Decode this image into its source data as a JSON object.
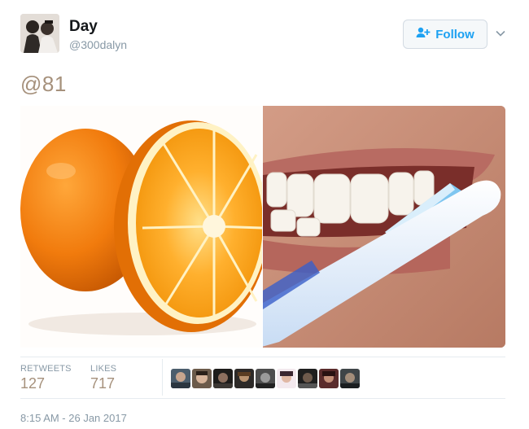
{
  "tweet": {
    "author_name": "Day",
    "author_handle": "@300dalyn",
    "text": "@81",
    "follow_label": "Follow",
    "timestamp": "8:15 AM - 26 Jan 2017"
  },
  "stats": {
    "retweets_label": "RETWEETS",
    "retweets_value": "127",
    "likes_label": "LIKES",
    "likes_value": "717"
  },
  "colors": {
    "accent": "#1da1f2",
    "muted": "#8899a6",
    "tweet_text": "#a6917c"
  },
  "icons": [
    "person-add-icon",
    "chevron-down-icon"
  ],
  "media": [
    "photo-orange",
    "photo-toothbrush"
  ],
  "likers_count_shown": 10
}
